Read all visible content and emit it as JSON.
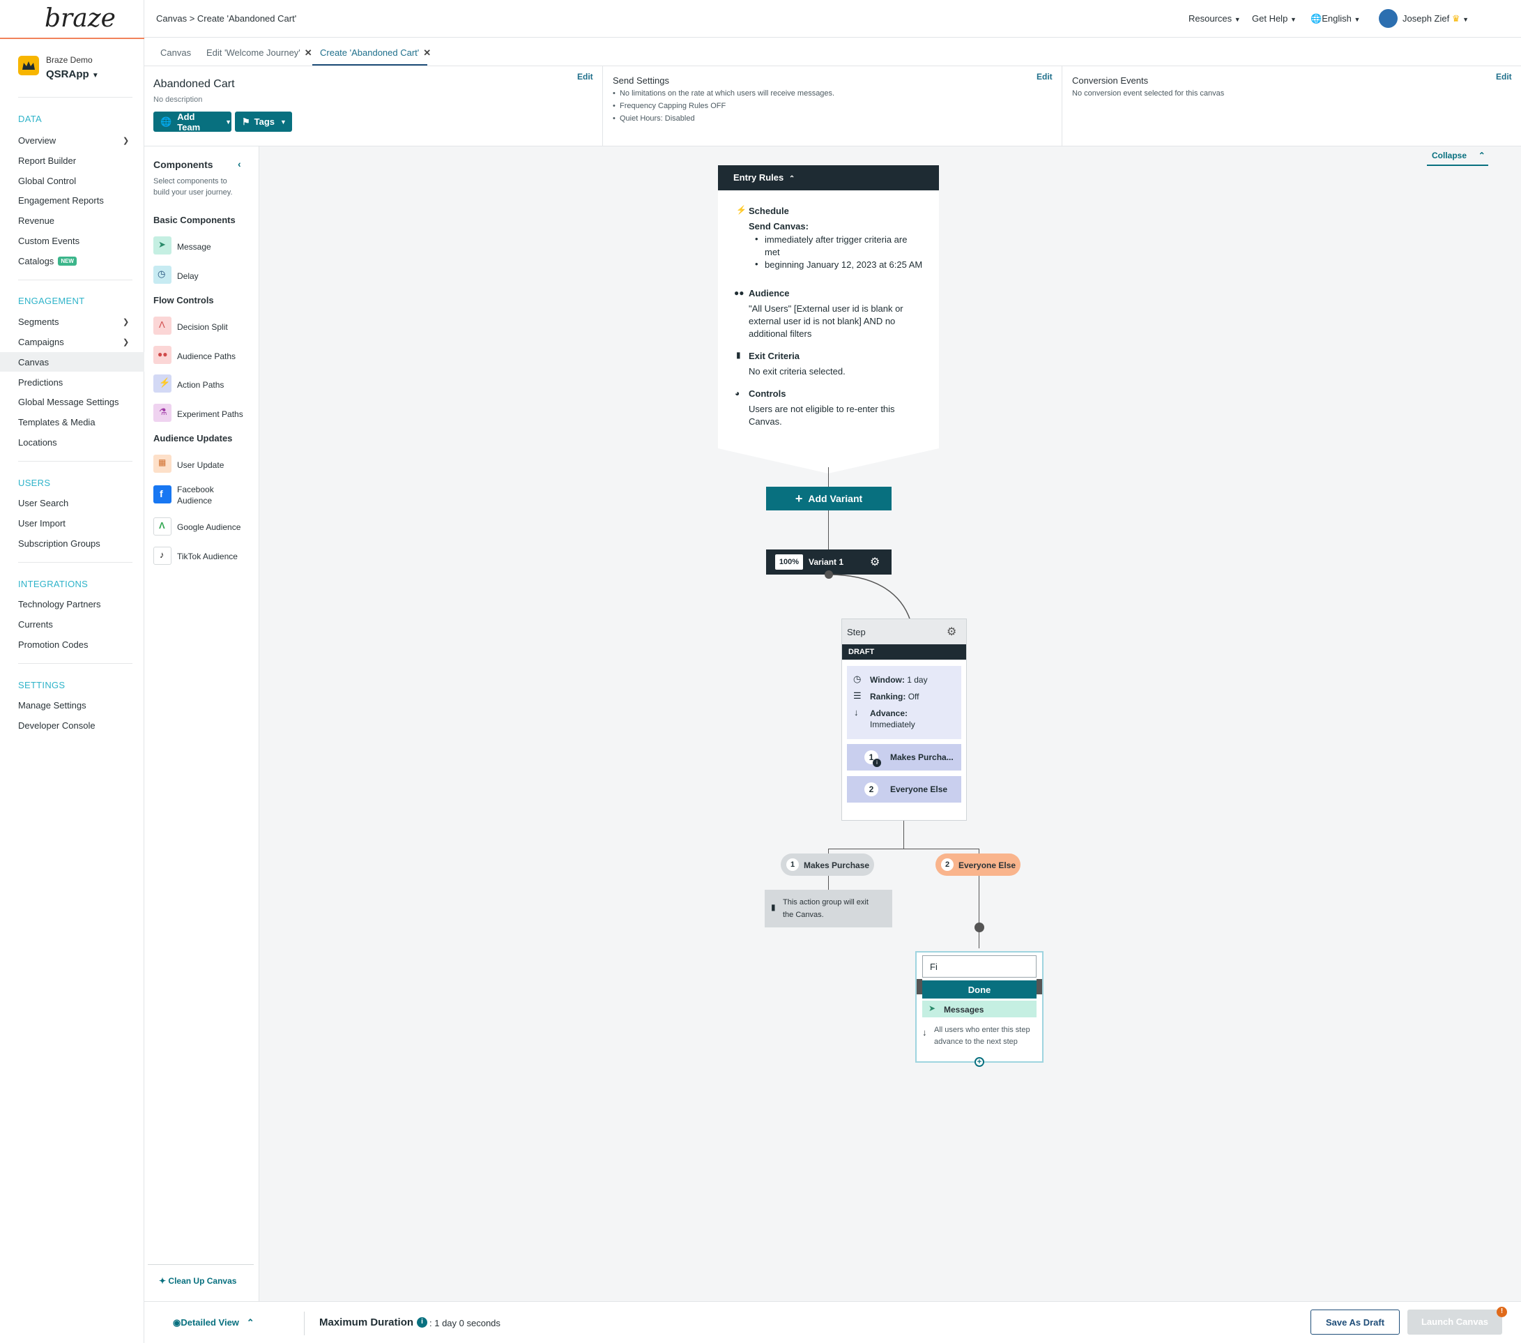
{
  "brand": {
    "logo": "braze",
    "accent": "#08707f"
  },
  "app": {
    "workspace": "Braze Demo",
    "name": "QSRApp"
  },
  "nav": {
    "data_title": "DATA",
    "data_items": [
      "Overview",
      "Report Builder",
      "Global Control",
      "Engagement Reports",
      "Revenue",
      "Custom Events",
      "Catalogs"
    ],
    "catalogs_badge": "NEW",
    "engagement_title": "ENGAGEMENT",
    "engagement_items": [
      "Segments",
      "Campaigns",
      "Canvas",
      "Predictions",
      "Global Message Settings",
      "Templates & Media",
      "Locations"
    ],
    "users_title": "USERS",
    "users_items": [
      "User Search",
      "User Import",
      "Subscription Groups"
    ],
    "integrations_title": "INTEGRATIONS",
    "integrations_items": [
      "Technology Partners",
      "Currents",
      "Promotion Codes"
    ],
    "settings_title": "SETTINGS",
    "settings_items": [
      "Manage Settings",
      "Developer Console"
    ]
  },
  "topbar": {
    "breadcrumb": "Canvas > Create 'Abandoned Cart'",
    "resources": "Resources",
    "help": "Get Help",
    "language": "English",
    "user": "Joseph Zief"
  },
  "tabs": [
    "Canvas",
    "Edit 'Welcome Journey'",
    "Create 'Abandoned Cart'"
  ],
  "header": {
    "title": "Abandoned Cart",
    "description": "No description",
    "add_team": "Add Team",
    "tags": "Tags",
    "edit": "Edit",
    "send_settings_title": "Send Settings",
    "send_settings": [
      "No limitations on the rate at which users will receive messages.",
      "Frequency Capping Rules OFF",
      "Quiet Hours: Disabled"
    ],
    "conversion_title": "Conversion Events",
    "conversion_text": "No conversion event selected for this canvas"
  },
  "components": {
    "title": "Components",
    "subtitle_1": "Select components to",
    "subtitle_2": "build your user journey.",
    "basic_title": "Basic Components",
    "message": "Message",
    "delay": "Delay",
    "flow_title": "Flow Controls",
    "decision_split": "Decision Split",
    "audience_paths": "Audience Paths",
    "action_paths": "Action Paths",
    "experiment_paths": "Experiment Paths",
    "audience_updates_title": "Audience Updates",
    "user_update": "User Update",
    "facebook_1": "Facebook",
    "facebook_2": "Audience",
    "google": "Google Audience",
    "tiktok": "TikTok Audience",
    "cleanup": "Clean Up Canvas"
  },
  "canvas": {
    "collapse": "Collapse",
    "entry_rules": {
      "title": "Entry Rules",
      "schedule_title": "Schedule",
      "send_canvas": "Send Canvas:",
      "bullet_1a": "immediately after trigger criteria are",
      "bullet_1b": "met",
      "bullet_2": "beginning January 12, 2023 at 6:25 AM",
      "audience_title": "Audience",
      "audience_1": "\"All Users\" [External user id is blank or",
      "audience_2": "external user id is not blank] AND no",
      "audience_3": "additional filters",
      "exit_title": "Exit Criteria",
      "exit_text": "No exit criteria selected.",
      "controls_title": "Controls",
      "controls_1": "Users are not eligible to re-enter this",
      "controls_2": "Canvas."
    },
    "add_variant": "Add Variant",
    "variant": {
      "percent": "100%",
      "name": "Variant 1"
    },
    "step": {
      "title": "Step",
      "status": "DRAFT",
      "window_label": "Window:",
      "window_value": "1 day",
      "ranking_label": "Ranking:",
      "ranking_value": "Off",
      "advance_label": "Advance:",
      "advance_value": "Immediately",
      "group_1_num": "1",
      "group_1": "Makes Purcha...",
      "group_2_num": "2",
      "group_2": "Everyone Else"
    },
    "path_1_num": "1",
    "path_1": "Makes Purchase",
    "path_2_num": "2",
    "path_2": "Everyone Else",
    "exit_note_1": "This action group will exit",
    "exit_note_2": "the Canvas.",
    "new_step": {
      "input_value": "Fi",
      "done": "Done",
      "messages": "Messages",
      "advance_1": "All users who enter this step",
      "advance_2": "advance to the next step"
    }
  },
  "bottom": {
    "detailed_view": "Detailed View",
    "max_duration_label": "Maximum Duration",
    "max_duration_value": ": 1 day 0 seconds",
    "save_draft": "Save As Draft",
    "launch": "Launch Canvas",
    "alert_count": "!"
  }
}
